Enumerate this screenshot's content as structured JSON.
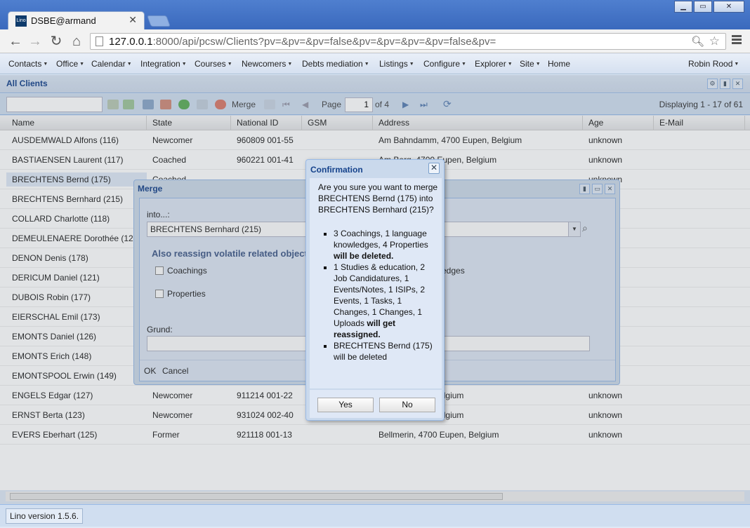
{
  "browser": {
    "tab_title": "DSBE@armand",
    "favicon_text": "Lino",
    "url_host": "127.0.0.1",
    "url_rest": ":8000/api/pcsw/Clients?pv=&pv=&pv=false&pv=&pv=&pv=&pv=false&pv="
  },
  "menu": {
    "items": [
      "Contacts",
      "Office",
      "Calendar",
      "Integration",
      "Courses",
      "Newcomers",
      "Debts mediation",
      "Listings",
      "Configure",
      "Explorer",
      "Site",
      "Home"
    ],
    "user": "Robin Rood"
  },
  "panel": {
    "title": "All Clients"
  },
  "grid_toolbar": {
    "merge_label": "Merge",
    "page_label": "Page",
    "page_value": "1",
    "of_label": "of 4",
    "display_info": "Displaying 1 - 17 of 61"
  },
  "grid": {
    "columns": [
      "Name",
      "State",
      "National ID",
      "GSM",
      "Address",
      "Age",
      "E-Mail"
    ],
    "rows": [
      {
        "name": "AUSDEMWALD Alfons (116)",
        "state": "Newcomer",
        "nid": "960809 001-55",
        "address": "Am Bahndamm, 4700 Eupen, Belgium",
        "age": "unknown"
      },
      {
        "name": "BASTIAENSEN Laurent (117)",
        "state": "Coached",
        "nid": "960221 001-41",
        "address": "Am Berg, 4700 Eupen, Belgium",
        "age": "unknown"
      },
      {
        "name": "BRECHTENS Bernd (175)",
        "state": "Coached",
        "nid": "",
        "address": "",
        "age": "unknown"
      },
      {
        "name": "BRECHTENS Bernhard (215)",
        "state": "",
        "nid": "",
        "address": "",
        "age": ""
      },
      {
        "name": "COLLARD Charlotte (118)",
        "state": "",
        "nid": "",
        "address": "",
        "age": ""
      },
      {
        "name": "DEMEULENAERE Dorothée (12",
        "state": "",
        "nid": "",
        "address": "",
        "age": ""
      },
      {
        "name": "DENON Denis (178)",
        "state": "",
        "nid": "",
        "address": "",
        "age": ""
      },
      {
        "name": "DERICUM Daniel (121)",
        "state": "",
        "nid": "",
        "address": "",
        "age": ""
      },
      {
        "name": "DUBOIS Robin (177)",
        "state": "",
        "nid": "",
        "address": "",
        "age": ""
      },
      {
        "name": "EIERSCHAL Emil (173)",
        "state": "",
        "nid": "",
        "address": "",
        "age": ""
      },
      {
        "name": "EMONTS Daniel (126)",
        "state": "",
        "nid": "",
        "address": "",
        "age": ""
      },
      {
        "name": "EMONTS Erich (148)",
        "state": "",
        "nid": "",
        "address": "",
        "age": ""
      },
      {
        "name": "EMONTSPOOL Erwin (149)",
        "state": "",
        "nid": "",
        "address": "",
        "age": ""
      },
      {
        "name": "ENGELS Edgar (127)",
        "state": "Newcomer",
        "nid": "911214 001-22",
        "address": ", 4700 Eupen, Belgium",
        "age": "unknown"
      },
      {
        "name": "ERNST Berta (123)",
        "state": "Newcomer",
        "nid": "931024 002-40",
        "address": ", 4700 Eupen, Belgium",
        "age": "unknown"
      },
      {
        "name": "EVERS Eberhart (125)",
        "state": "Former",
        "nid": "921118 001-13",
        "address": "Bellmerin, 4700 Eupen, Belgium",
        "age": "unknown"
      }
    ]
  },
  "status": {
    "version": "Lino version 1.5.6."
  },
  "merge_window": {
    "title": "Merge",
    "into_label": "into...:",
    "into_value": "BRECHTENS Bernhard (215)",
    "section_label": "Also reassign volatile related objects",
    "cb_coachings": "Coachings",
    "cb_knowledges_tail": "edges",
    "cb_properties": "Properties",
    "reason_label": "Grund:",
    "ok_label": "OK",
    "cancel_label": "Cancel"
  },
  "confirm": {
    "title": "Confirmation",
    "question": "Are you sure you want to merge BRECHTENS Bernd (175) into BRECHTENS Bernhard (215)?",
    "bullet1_text": "3 Coachings, 1 language knowledges, 4 Properties",
    "bullet1_bold": "will be deleted.",
    "bullet2_text": "1 Studies & education, 2 Job Candidatures, 1 Events/Notes, 1 ISIPs, 2 Events, 1 Tasks, 1 Changes, 1 Changes, 1 Uploads",
    "bullet2_bold": "will get reassigned.",
    "bullet3_text": "BRECHTENS Bernd (175) will be deleted",
    "yes_label": "Yes",
    "no_label": "No"
  },
  "icons": {
    "back": "arrow-left",
    "forward": "arrow-right",
    "reload": "reload",
    "home": "home",
    "zoom": "magnifier",
    "bookmark": "star",
    "menu": "hamburger"
  },
  "colors": {
    "accent": "#15428b",
    "panel_bg": "#dfe8f6",
    "titlebar": "#3a69bd"
  }
}
